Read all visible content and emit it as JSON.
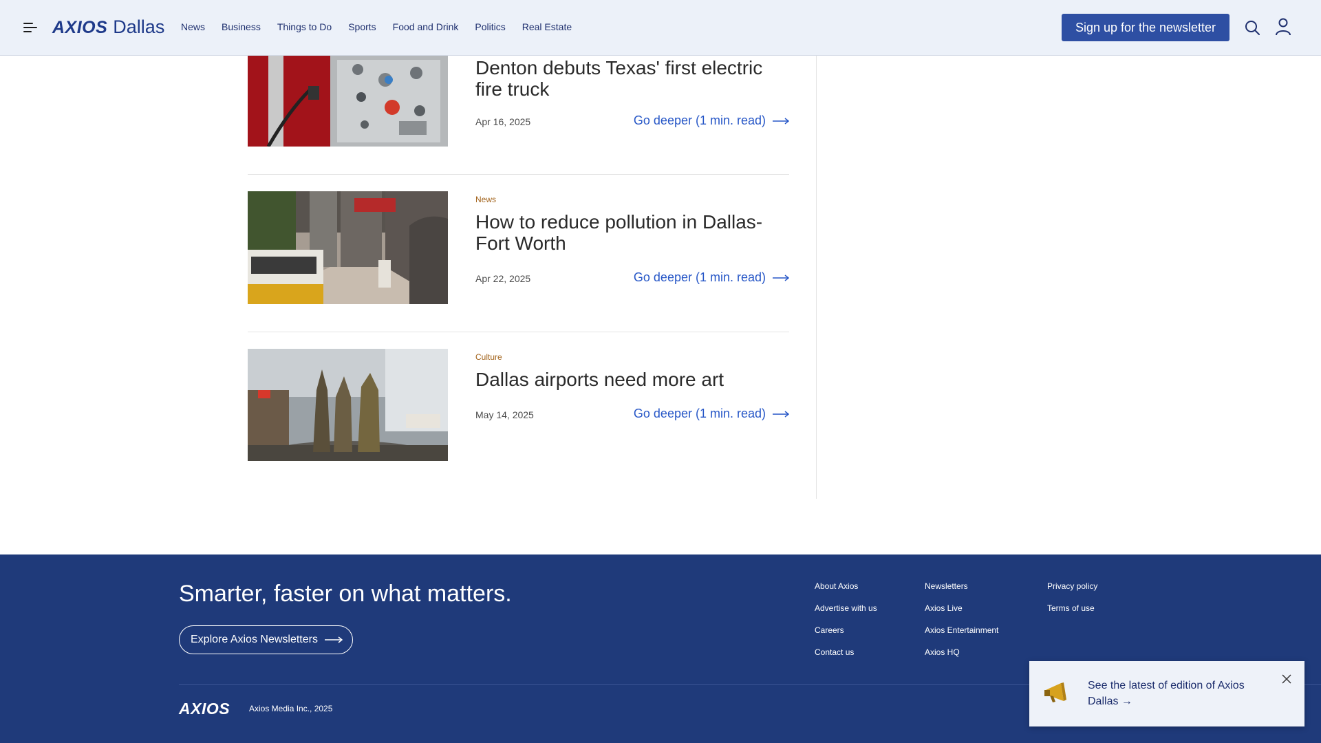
{
  "header": {
    "logo_brand": "AXIOS",
    "logo_city": "Dallas",
    "nav": [
      "News",
      "Business",
      "Things to Do",
      "Sports",
      "Food and Drink",
      "Politics",
      "Real Estate"
    ],
    "signup_label": "Sign up for the newsletter"
  },
  "articles": [
    {
      "kicker": "",
      "title": "Denton debuts Texas' first electric fire truck",
      "date": "Apr 16, 2025",
      "more": "Go deeper (1 min. read)"
    },
    {
      "kicker": "News",
      "title": "How to reduce pollution in Dallas-Fort Worth",
      "date": "Apr 22, 2025",
      "more": "Go deeper (1 min. read)"
    },
    {
      "kicker": "Culture",
      "title": "Dallas airports need more art",
      "date": "May 14, 2025",
      "more": "Go deeper (1 min. read)"
    }
  ],
  "footer": {
    "tagline": "Smarter, faster on what matters.",
    "explore_label": "Explore Axios Newsletters",
    "col1": [
      "About Axios",
      "Advertise with us",
      "Careers",
      "Contact us"
    ],
    "col2": [
      "Newsletters",
      "Axios Live",
      "Axios Entertainment",
      "Axios HQ"
    ],
    "col3": [
      "Privacy policy",
      "Terms of use"
    ],
    "logo": "AXIOS",
    "copyright": "Axios Media Inc., 2025"
  },
  "toast": {
    "text": "See the latest of edition of Axios Dallas →"
  },
  "colors": {
    "brand": "#1e3a8a",
    "button": "#2e4fa3",
    "footer_bg": "#1f3a7a",
    "link": "#2757c7",
    "kicker": "#a2621a"
  },
  "icons": [
    "hamburger-icon",
    "search-icon",
    "user-icon",
    "arrow-right-icon",
    "megaphone-icon",
    "close-icon"
  ]
}
